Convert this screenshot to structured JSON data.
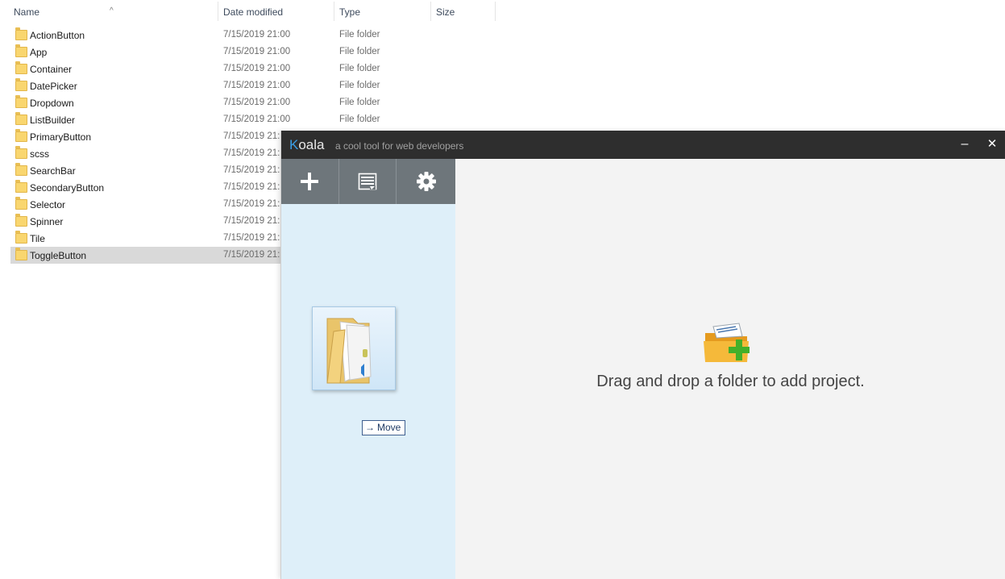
{
  "explorer": {
    "columns": {
      "name": "Name",
      "date_modified": "Date modified",
      "type": "Type",
      "size": "Size"
    },
    "sort_indicator": "^",
    "rows": [
      {
        "name": "ActionButton",
        "date": "7/15/2019 21:00",
        "type": "File folder"
      },
      {
        "name": "App",
        "date": "7/15/2019 21:00",
        "type": "File folder"
      },
      {
        "name": "Container",
        "date": "7/15/2019 21:00",
        "type": "File folder"
      },
      {
        "name": "DatePicker",
        "date": "7/15/2019 21:00",
        "type": "File folder"
      },
      {
        "name": "Dropdown",
        "date": "7/15/2019 21:00",
        "type": "File folder"
      },
      {
        "name": "ListBuilder",
        "date": "7/15/2019 21:00",
        "type": "File folder"
      },
      {
        "name": "PrimaryButton",
        "date": "7/15/2019 21:",
        "type": ""
      },
      {
        "name": "scss",
        "date": "7/15/2019 21:",
        "type": ""
      },
      {
        "name": "SearchBar",
        "date": "7/15/2019 21:",
        "type": ""
      },
      {
        "name": "SecondaryButton",
        "date": "7/15/2019 21:",
        "type": ""
      },
      {
        "name": "Selector",
        "date": "7/15/2019 21:",
        "type": ""
      },
      {
        "name": "Spinner",
        "date": "7/15/2019 21:",
        "type": ""
      },
      {
        "name": "Tile",
        "date": "7/15/2019 21:",
        "type": ""
      },
      {
        "name": "ToggleButton",
        "date": "7/15/2019 21:",
        "type": "",
        "selected": true
      }
    ]
  },
  "koala": {
    "title_k": "K",
    "title_rest": "oala",
    "subtitle": "a cool tool for web developers",
    "minimize_label": "–",
    "close_label": "✕",
    "toolbar": {
      "add_icon": "plus-icon",
      "log_icon": "document-icon",
      "settings_icon": "gear-icon"
    },
    "drag_tooltip": {
      "arrow": "→",
      "label": "Move"
    },
    "main_hint": "Drag and drop a folder to add project.",
    "colors": {
      "titlebar": "#2e2e2e",
      "accent": "#3aa0e8",
      "sidebar": "#deeff9",
      "toolbar": "#6e767b",
      "main": "#f3f3f3"
    }
  }
}
